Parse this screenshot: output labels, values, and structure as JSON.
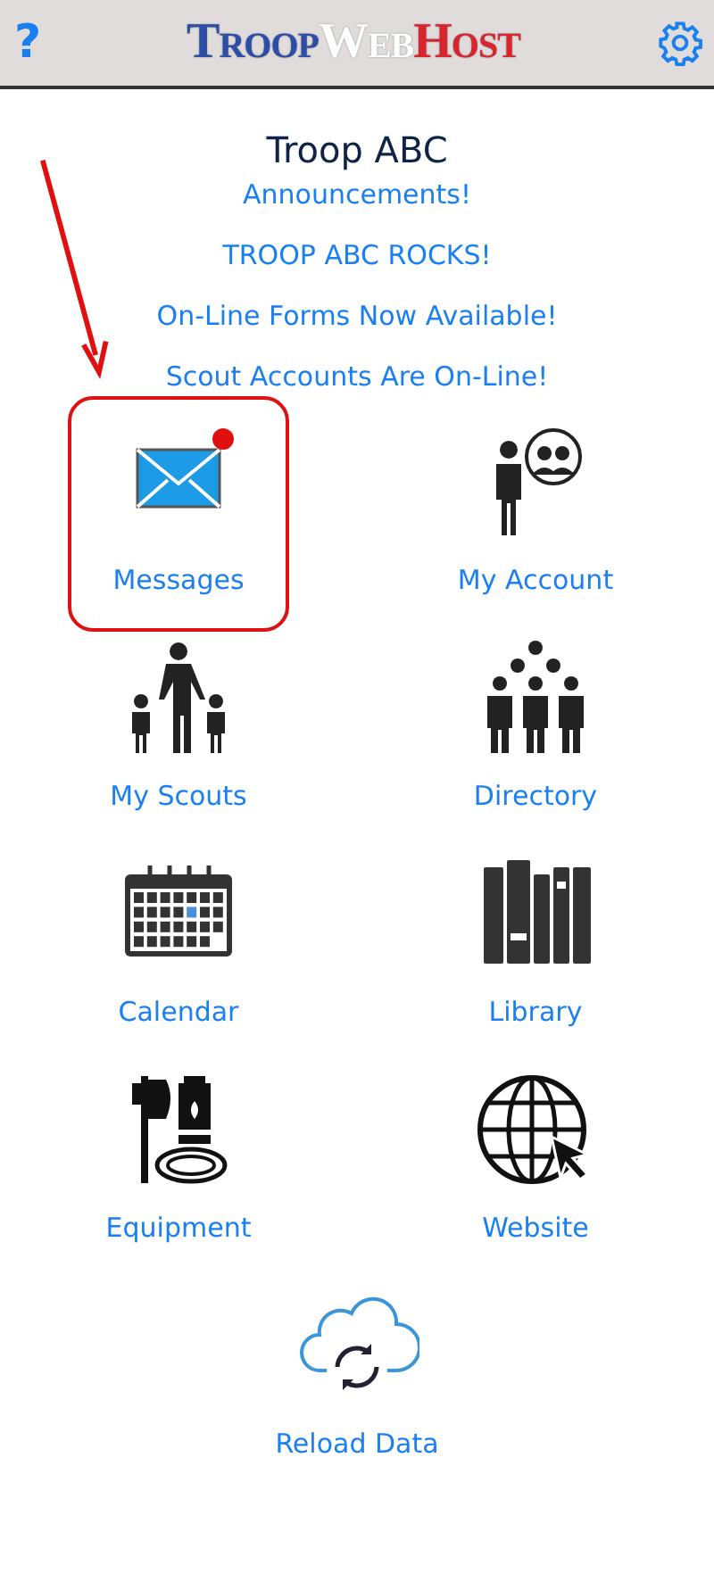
{
  "header": {
    "help": "?",
    "logo": [
      {
        "text": "Troop",
        "color": "#2c4ea6"
      },
      {
        "text": "Web",
        "color": "#ffffff"
      },
      {
        "text": "Host",
        "color": "#d8242c"
      }
    ]
  },
  "title": "Troop ABC",
  "announcements": [
    "Announcements!",
    "TROOP ABC ROCKS!",
    "On-Line Forms Now Available!",
    "Scout Accounts Are On-Line!"
  ],
  "tiles": [
    {
      "label": "Messages",
      "kind": "envelope",
      "unread": true,
      "highlighted": true
    },
    {
      "label": "My Account",
      "kind": "account",
      "unread": false,
      "highlighted": false
    },
    {
      "label": "My Scouts",
      "kind": "family",
      "unread": false,
      "highlighted": false
    },
    {
      "label": "Directory",
      "kind": "group",
      "unread": false,
      "highlighted": false
    },
    {
      "label": "Calendar",
      "kind": "calendar",
      "unread": false,
      "highlighted": false
    },
    {
      "label": "Library",
      "kind": "books",
      "unread": false,
      "highlighted": false
    },
    {
      "label": "Equipment",
      "kind": "equipment",
      "unread": false,
      "highlighted": false
    },
    {
      "label": "Website",
      "kind": "globe",
      "unread": false,
      "highlighted": false
    },
    {
      "label": "Reload Data",
      "kind": "cloud",
      "unread": false,
      "highlighted": false
    }
  ]
}
